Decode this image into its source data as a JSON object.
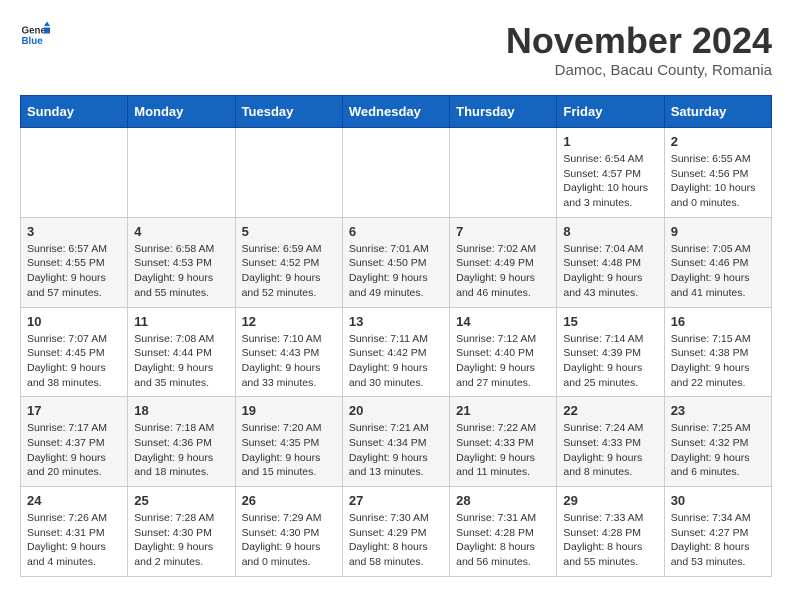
{
  "header": {
    "logo_general": "General",
    "logo_blue": "Blue",
    "month_title": "November 2024",
    "subtitle": "Damoc, Bacau County, Romania"
  },
  "days_of_week": [
    "Sunday",
    "Monday",
    "Tuesday",
    "Wednesday",
    "Thursday",
    "Friday",
    "Saturday"
  ],
  "weeks": [
    [
      {
        "day": "",
        "info": ""
      },
      {
        "day": "",
        "info": ""
      },
      {
        "day": "",
        "info": ""
      },
      {
        "day": "",
        "info": ""
      },
      {
        "day": "",
        "info": ""
      },
      {
        "day": "1",
        "info": "Sunrise: 6:54 AM\nSunset: 4:57 PM\nDaylight: 10 hours\nand 3 minutes."
      },
      {
        "day": "2",
        "info": "Sunrise: 6:55 AM\nSunset: 4:56 PM\nDaylight: 10 hours\nand 0 minutes."
      }
    ],
    [
      {
        "day": "3",
        "info": "Sunrise: 6:57 AM\nSunset: 4:55 PM\nDaylight: 9 hours\nand 57 minutes."
      },
      {
        "day": "4",
        "info": "Sunrise: 6:58 AM\nSunset: 4:53 PM\nDaylight: 9 hours\nand 55 minutes."
      },
      {
        "day": "5",
        "info": "Sunrise: 6:59 AM\nSunset: 4:52 PM\nDaylight: 9 hours\nand 52 minutes."
      },
      {
        "day": "6",
        "info": "Sunrise: 7:01 AM\nSunset: 4:50 PM\nDaylight: 9 hours\nand 49 minutes."
      },
      {
        "day": "7",
        "info": "Sunrise: 7:02 AM\nSunset: 4:49 PM\nDaylight: 9 hours\nand 46 minutes."
      },
      {
        "day": "8",
        "info": "Sunrise: 7:04 AM\nSunset: 4:48 PM\nDaylight: 9 hours\nand 43 minutes."
      },
      {
        "day": "9",
        "info": "Sunrise: 7:05 AM\nSunset: 4:46 PM\nDaylight: 9 hours\nand 41 minutes."
      }
    ],
    [
      {
        "day": "10",
        "info": "Sunrise: 7:07 AM\nSunset: 4:45 PM\nDaylight: 9 hours\nand 38 minutes."
      },
      {
        "day": "11",
        "info": "Sunrise: 7:08 AM\nSunset: 4:44 PM\nDaylight: 9 hours\nand 35 minutes."
      },
      {
        "day": "12",
        "info": "Sunrise: 7:10 AM\nSunset: 4:43 PM\nDaylight: 9 hours\nand 33 minutes."
      },
      {
        "day": "13",
        "info": "Sunrise: 7:11 AM\nSunset: 4:42 PM\nDaylight: 9 hours\nand 30 minutes."
      },
      {
        "day": "14",
        "info": "Sunrise: 7:12 AM\nSunset: 4:40 PM\nDaylight: 9 hours\nand 27 minutes."
      },
      {
        "day": "15",
        "info": "Sunrise: 7:14 AM\nSunset: 4:39 PM\nDaylight: 9 hours\nand 25 minutes."
      },
      {
        "day": "16",
        "info": "Sunrise: 7:15 AM\nSunset: 4:38 PM\nDaylight: 9 hours\nand 22 minutes."
      }
    ],
    [
      {
        "day": "17",
        "info": "Sunrise: 7:17 AM\nSunset: 4:37 PM\nDaylight: 9 hours\nand 20 minutes."
      },
      {
        "day": "18",
        "info": "Sunrise: 7:18 AM\nSunset: 4:36 PM\nDaylight: 9 hours\nand 18 minutes."
      },
      {
        "day": "19",
        "info": "Sunrise: 7:20 AM\nSunset: 4:35 PM\nDaylight: 9 hours\nand 15 minutes."
      },
      {
        "day": "20",
        "info": "Sunrise: 7:21 AM\nSunset: 4:34 PM\nDaylight: 9 hours\nand 13 minutes."
      },
      {
        "day": "21",
        "info": "Sunrise: 7:22 AM\nSunset: 4:33 PM\nDaylight: 9 hours\nand 11 minutes."
      },
      {
        "day": "22",
        "info": "Sunrise: 7:24 AM\nSunset: 4:33 PM\nDaylight: 9 hours\nand 8 minutes."
      },
      {
        "day": "23",
        "info": "Sunrise: 7:25 AM\nSunset: 4:32 PM\nDaylight: 9 hours\nand 6 minutes."
      }
    ],
    [
      {
        "day": "24",
        "info": "Sunrise: 7:26 AM\nSunset: 4:31 PM\nDaylight: 9 hours\nand 4 minutes."
      },
      {
        "day": "25",
        "info": "Sunrise: 7:28 AM\nSunset: 4:30 PM\nDaylight: 9 hours\nand 2 minutes."
      },
      {
        "day": "26",
        "info": "Sunrise: 7:29 AM\nSunset: 4:30 PM\nDaylight: 9 hours\nand 0 minutes."
      },
      {
        "day": "27",
        "info": "Sunrise: 7:30 AM\nSunset: 4:29 PM\nDaylight: 8 hours\nand 58 minutes."
      },
      {
        "day": "28",
        "info": "Sunrise: 7:31 AM\nSunset: 4:28 PM\nDaylight: 8 hours\nand 56 minutes."
      },
      {
        "day": "29",
        "info": "Sunrise: 7:33 AM\nSunset: 4:28 PM\nDaylight: 8 hours\nand 55 minutes."
      },
      {
        "day": "30",
        "info": "Sunrise: 7:34 AM\nSunset: 4:27 PM\nDaylight: 8 hours\nand 53 minutes."
      }
    ]
  ]
}
